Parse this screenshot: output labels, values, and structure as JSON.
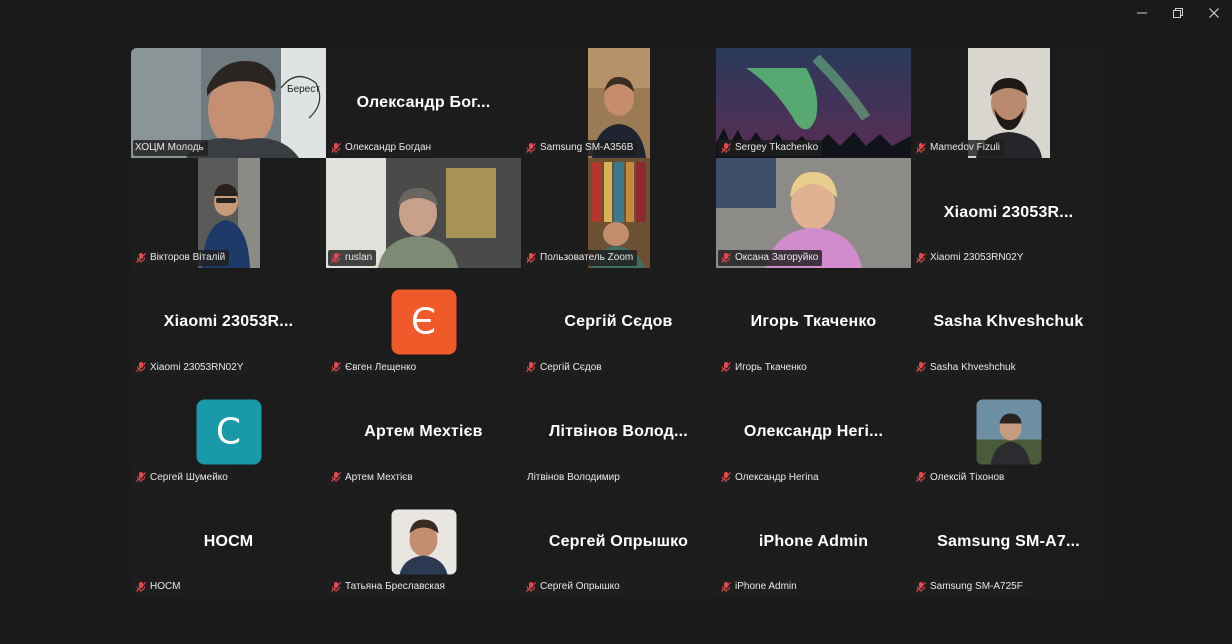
{
  "window": {
    "minimize": "—",
    "restore": "❐",
    "close": "✕"
  },
  "tiles": [
    {
      "name": "ХОЦМ Молодь",
      "big": "",
      "overlay_text": "Берест",
      "muted": false
    },
    {
      "name": "Олександр Богдан",
      "big": "Олександр  Бог...",
      "muted": true
    },
    {
      "name": "Samsung SM-A356B",
      "big": "",
      "muted": true
    },
    {
      "name": "Sergey Tkachenko",
      "big": "",
      "muted": true
    },
    {
      "name": "Mamedov Fizuli",
      "big": "",
      "muted": true
    },
    {
      "name": "Вікторов Віталій",
      "big": "",
      "muted": true
    },
    {
      "name": "ruslan",
      "big": "",
      "muted": true
    },
    {
      "name": "Пользователь Zoom",
      "big": "",
      "muted": true
    },
    {
      "name": "Оксана Загоруйко",
      "big": "",
      "muted": true
    },
    {
      "name": "Xiaomi 23053RN02Y",
      "big": "Xiaomi  23053R...",
      "muted": true
    },
    {
      "name": "Xiaomi 23053RN02Y",
      "big": "Xiaomi  23053R...",
      "muted": true
    },
    {
      "name": "Євген Лещенко",
      "big": "",
      "avatar_letter": "Є",
      "avatar_color": "#f0592a",
      "muted": true
    },
    {
      "name": "Сергій Сєдов",
      "big": "Сергій Сєдов",
      "muted": true
    },
    {
      "name": "Игорь Ткаченко",
      "big": "Игорь Ткаченко",
      "muted": true
    },
    {
      "name": "Sasha Khveshchuk",
      "big": "Sasha Khveshchuk",
      "muted": true
    },
    {
      "name": "Сергей Шумейко",
      "big": "",
      "avatar_letter": "С",
      "avatar_color": "#1a9aa8",
      "muted": true
    },
    {
      "name": "Артем Мехтієв",
      "big": "Артем Мехтієв",
      "muted": true
    },
    {
      "name": "Літвінов Володимир",
      "big": "Літвінов  Волод...",
      "muted": false
    },
    {
      "name": "Олександр Негіna",
      "big": "Олександр  Негі...",
      "muted": true
    },
    {
      "name": "Олексій Тіхонов",
      "big": "",
      "muted": true
    },
    {
      "name": "НОСМ",
      "big": "НОСМ",
      "muted": true
    },
    {
      "name": "Татьяна Бреславская",
      "big": "",
      "muted": true
    },
    {
      "name": "Сергей Опрышко",
      "big": "Сергей Опрышко",
      "muted": true
    },
    {
      "name": "iPhone Admin",
      "big": "iPhone Admin",
      "muted": true
    },
    {
      "name": "Samsung SM-A725F",
      "big": "Samsung  SM-A7...",
      "muted": true
    }
  ],
  "colors": {
    "active_speaker_border": "#3ad58e",
    "muted_icon": "#e5484d"
  }
}
